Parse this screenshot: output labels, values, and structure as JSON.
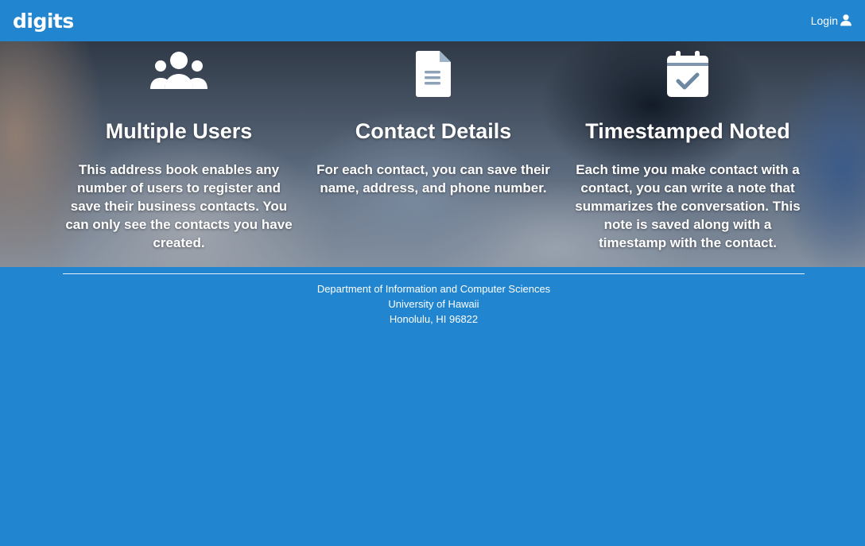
{
  "navbar": {
    "brand": "digits",
    "login_label": "Login",
    "login_icon": "user-icon"
  },
  "features": [
    {
      "icon": "users-icon",
      "title": "Multiple Users",
      "description": "This address book enables any number of users to register and save their business contacts. You can only see the contacts you have created."
    },
    {
      "icon": "file-text-icon",
      "title": "Contact Details",
      "description": "For each contact, you can save their name, address, and phone number."
    },
    {
      "icon": "calendar-check-icon",
      "title": "Timestamped Noted",
      "description": "Each time you make contact with a contact, you can write a note that summarizes the conversation. This note is saved along with a timestamp with the contact."
    }
  ],
  "footer": {
    "line1": "Department of Information and Computer Sciences",
    "line2": "University of Hawaii",
    "line3": "Honolulu, HI 96822"
  },
  "colors": {
    "primary": "#2185d0",
    "text": "#ffffff"
  }
}
